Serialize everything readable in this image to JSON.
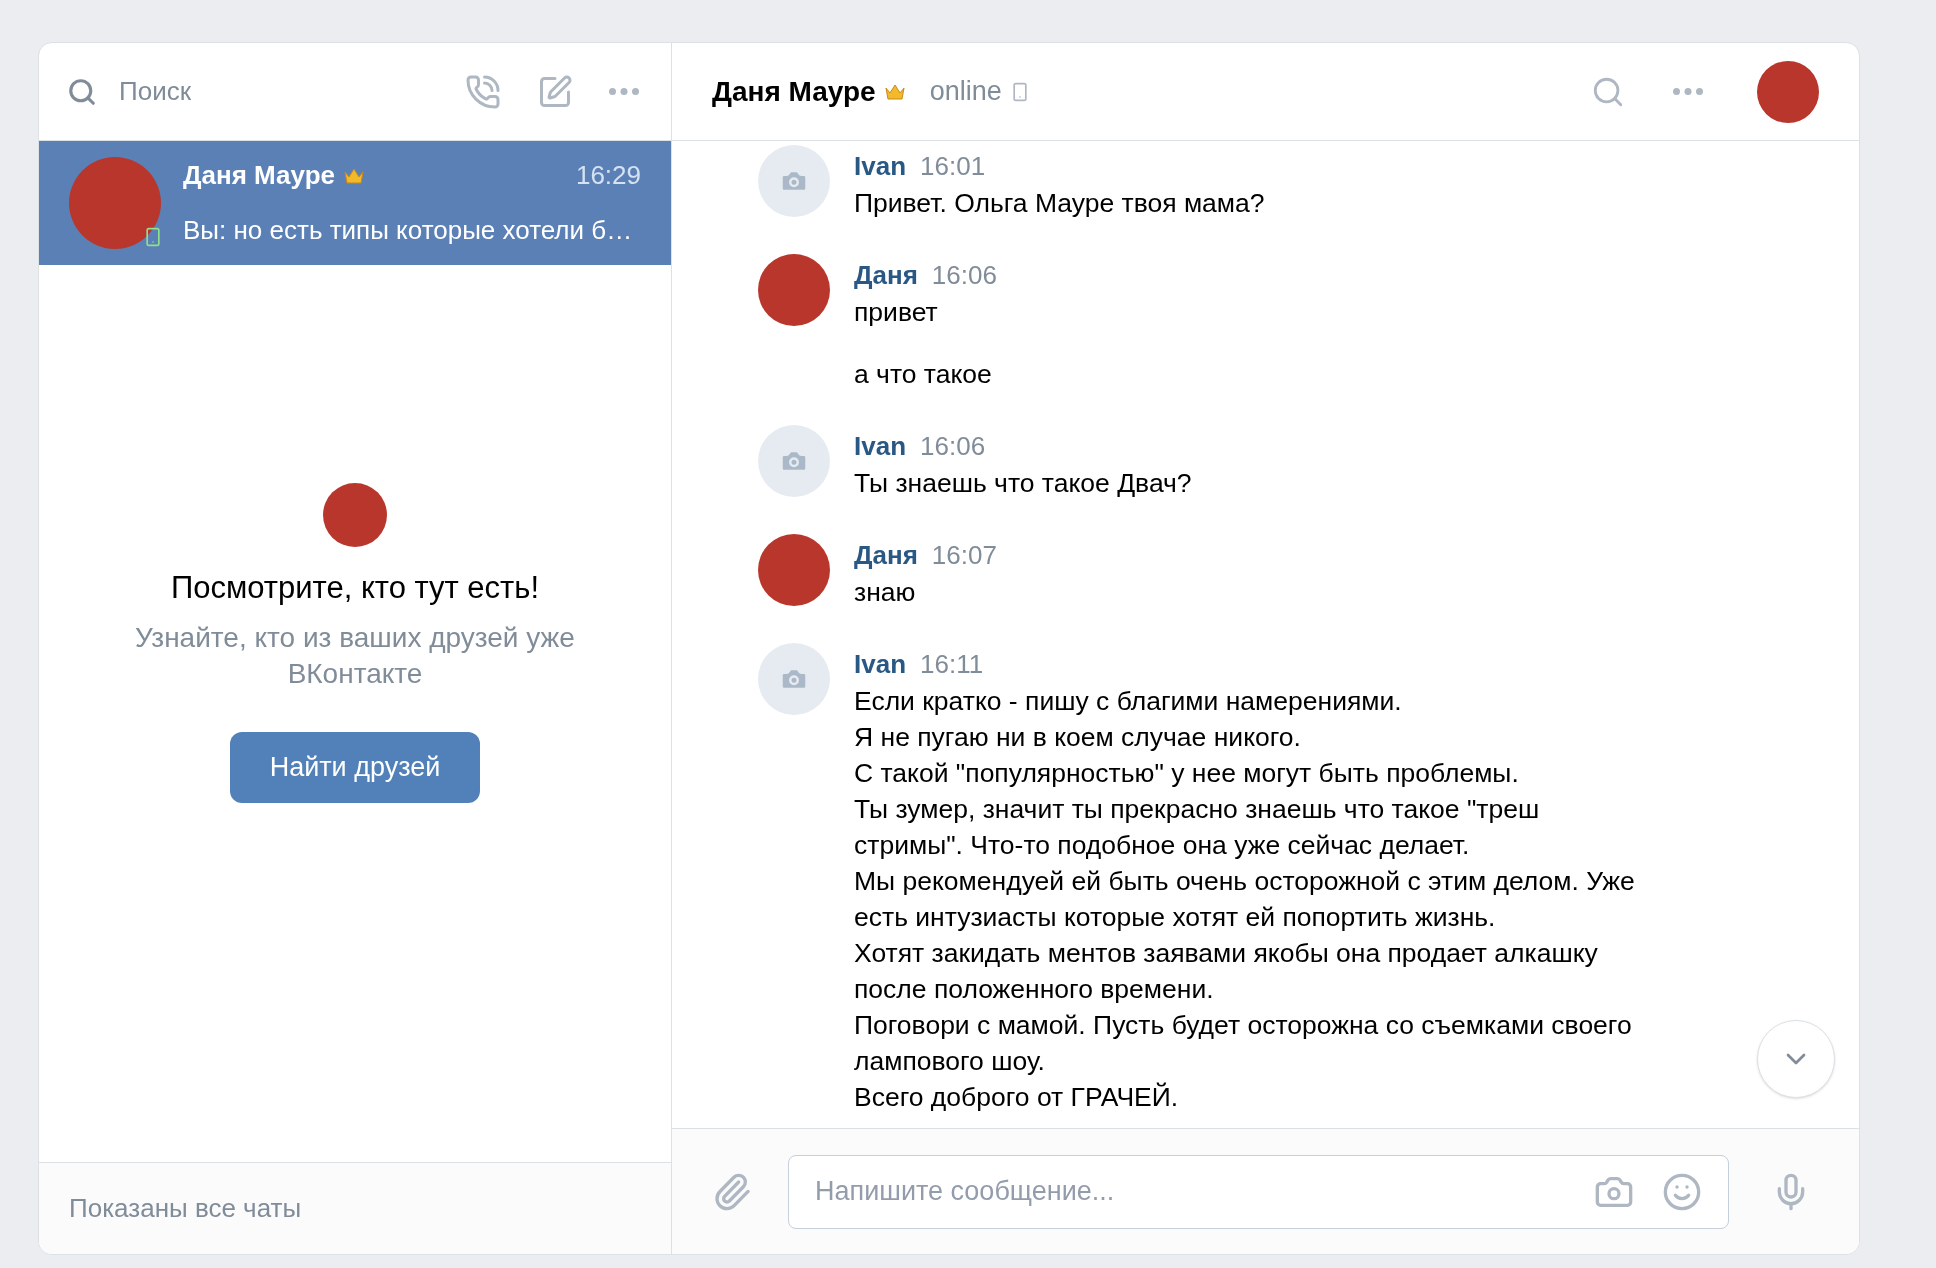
{
  "sidebar": {
    "search": {
      "placeholder": "Поиск"
    },
    "chats": [
      {
        "name": "Даня Мауре",
        "time": "16:29",
        "preview": "Вы: но есть типы которые хотели б…",
        "selected": true,
        "mobile": true
      }
    ],
    "empty_state": {
      "title": "Посмотрите, кто тут есть!",
      "text": "Узнайте, кто из ваших друзей уже ВКонтакте",
      "button": "Найти друзей"
    },
    "footer": "Показаны все чаты"
  },
  "chat": {
    "title": "Даня Мауре",
    "status": "online",
    "messages": [
      {
        "author": "Ivan",
        "time": "16:01",
        "kind": "camera",
        "texts": [
          "Привет. Ольга Мауре твоя мама?"
        ]
      },
      {
        "author": "Даня",
        "time": "16:06",
        "kind": "photo",
        "texts": [
          "привет",
          "а что такое"
        ]
      },
      {
        "author": "Ivan",
        "time": "16:06",
        "kind": "camera",
        "texts": [
          "Ты знаешь что такое Двач?"
        ]
      },
      {
        "author": "Даня",
        "time": "16:07",
        "kind": "photo",
        "texts": [
          "знаю"
        ]
      },
      {
        "author": "Ivan",
        "time": "16:11",
        "kind": "camera",
        "texts": [
          "Если кратко - пишу с благими намерениями.\nЯ не пугаю ни в коем случае никого.\nС такой \"популярностью\" у нее могут быть проблемы.\nТы зумер, значит ты прекрасно знаешь что такое \"треш стримы\". Что-то подобное она уже сейчас делает.\nМы рекомендуей ей быть очень осторожной с этим делом. Уже есть интузиасты которые хотят ей попортить жизнь.\nХотят закидать ментов заявами якобы она продает алкашку после положенного времени.\nПоговори с мамой. Пусть будет осторожна со съемками своего лампового шоу.\nВсего доброго от ГРАЧЕЙ."
        ]
      }
    ],
    "composer": {
      "placeholder": "Напишите сообщение..."
    }
  }
}
